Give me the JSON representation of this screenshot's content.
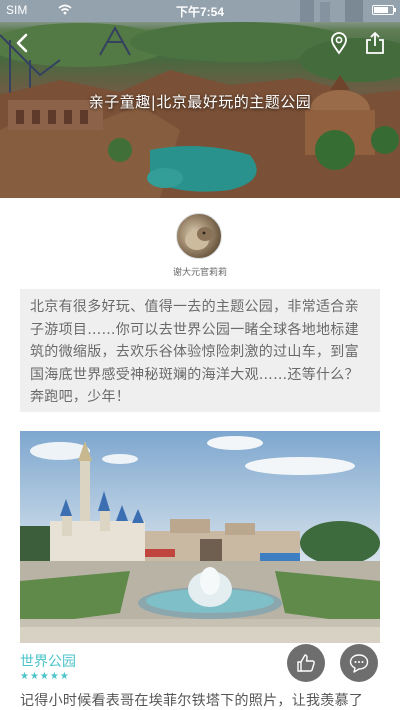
{
  "status_bar": {
    "carrier": "SIM",
    "time": "下午7:54"
  },
  "nav": {
    "back_icon": "chevron-left-icon",
    "location_icon": "location-pin-icon",
    "share_icon": "share-icon"
  },
  "hero": {
    "title": "亲子童趣|北京最好玩的主题公园"
  },
  "author": {
    "name": "谢大元官莉莉"
  },
  "intro": {
    "text": "北京有很多好玩、值得一去的主题公园，非常适合亲子游项目……你可以去世界公园一睹全球各地地标建筑的微缩版，去欢乐谷体验惊险刺激的过山车，到富国海底世界感受神秘斑斓的海洋大观……还等什么？奔跑吧，少年！"
  },
  "place": {
    "name": "世界公园",
    "rating": 5,
    "stars": "★★★★★",
    "description": "记得小时候看表哥在埃菲尔铁塔下的照片，让我羡慕了"
  },
  "actions": {
    "like_icon": "thumbs-up-icon",
    "comment_icon": "comment-bubble-icon"
  },
  "colors": {
    "accent": "#4cc3c8",
    "button_bg": "#6e6e6e",
    "intro_bg": "#efefef"
  }
}
